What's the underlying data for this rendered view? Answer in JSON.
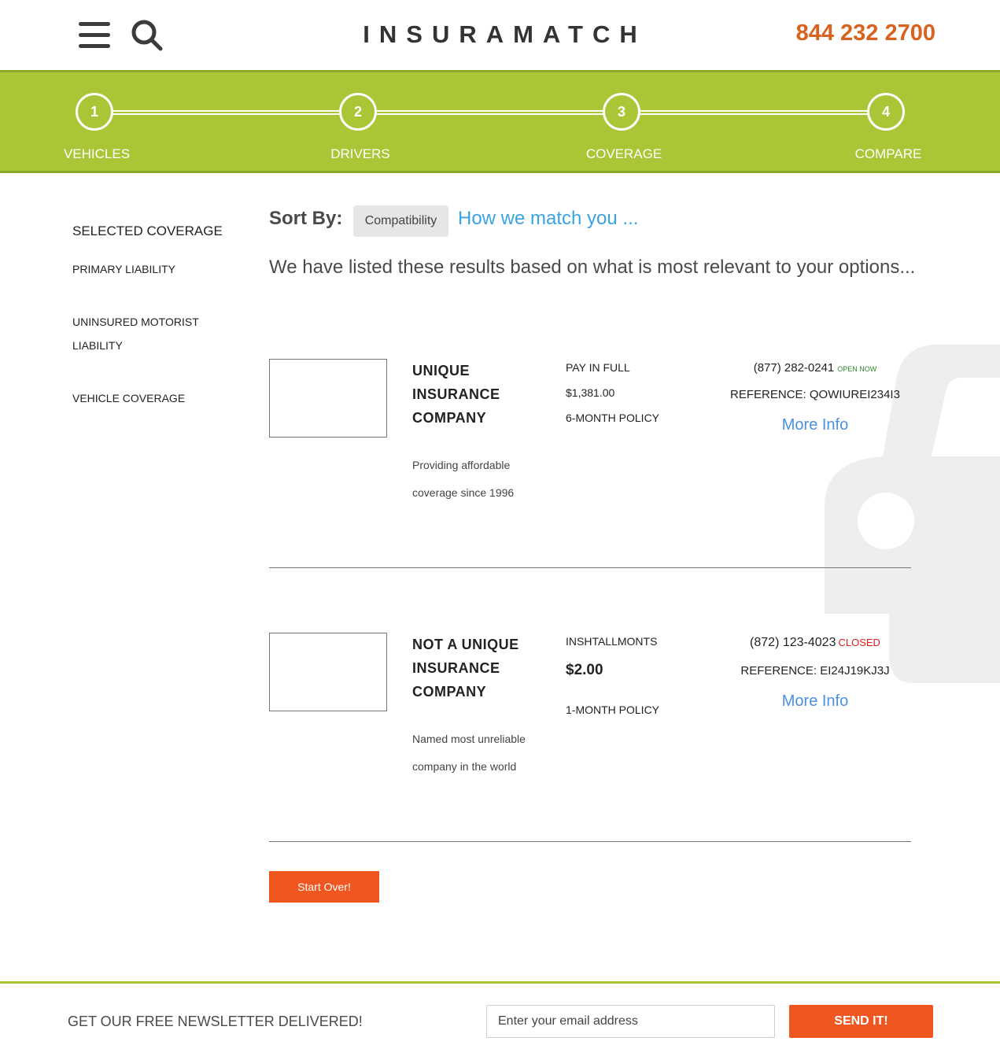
{
  "header": {
    "logo": "INSURAMATCH",
    "phone": "844 232 2700",
    "menu_icon": "hamburger-menu-icon",
    "search_icon": "search-icon"
  },
  "steps": [
    {
      "number": "1",
      "label": "VEHICLES"
    },
    {
      "number": "2",
      "label": "DRIVERS"
    },
    {
      "number": "3",
      "label": "COVERAGE"
    },
    {
      "number": "4",
      "label": "COMPARE"
    }
  ],
  "sidebar": {
    "title": "SELECTED COVERAGE",
    "items": [
      {
        "label": "PRIMARY LIABILITY"
      },
      {
        "label": "UNINSURED MOTORIST LIABILITY"
      },
      {
        "label": "VEHICLE COVERAGE"
      }
    ]
  },
  "sort": {
    "label": "Sort By:",
    "selected": "Compatibility",
    "match_link": "How we match you ..."
  },
  "intro": "We have listed these results based on what is most relevant to your options...",
  "results": [
    {
      "company": "UNIQUE INSURANCE COMPANY",
      "tagline": "Providing affordable coverage since 1996",
      "payment_type": "PAY IN FULL",
      "price": "$1,381.00",
      "term": "6-MONTH POLICY",
      "phone": "(877) 282-0241",
      "status": "OPEN NOW",
      "reference": "REFERENCE: QOWIUREI234I3",
      "more_info": "More Info"
    },
    {
      "company": "NOT A UNIQUE INSURANCE COMPANY",
      "tagline": "Named most unreliable company in the world",
      "payment_type": "INSHTALLMONTS",
      "price": "$2.00",
      "term": "1-MONTH POLICY",
      "phone": "(872) 123-4023",
      "status": "CLOSED",
      "reference": "REFERENCE: EI24J19KJ3J",
      "more_info": "More Info"
    }
  ],
  "start_over": "Start Over!",
  "footer": {
    "newsletter_label": "GET OUR FREE NEWSLETTER DELIVERED!",
    "email_placeholder": "Enter your email address",
    "send_label": "SEND IT!"
  },
  "colors": {
    "brand_green": "#a8c635",
    "accent_orange": "#f0561f",
    "phone_orange": "#d9621f",
    "link_blue": "#4a90e2",
    "open_green": "#2f8a2f",
    "closed_red": "#e21d1d"
  }
}
